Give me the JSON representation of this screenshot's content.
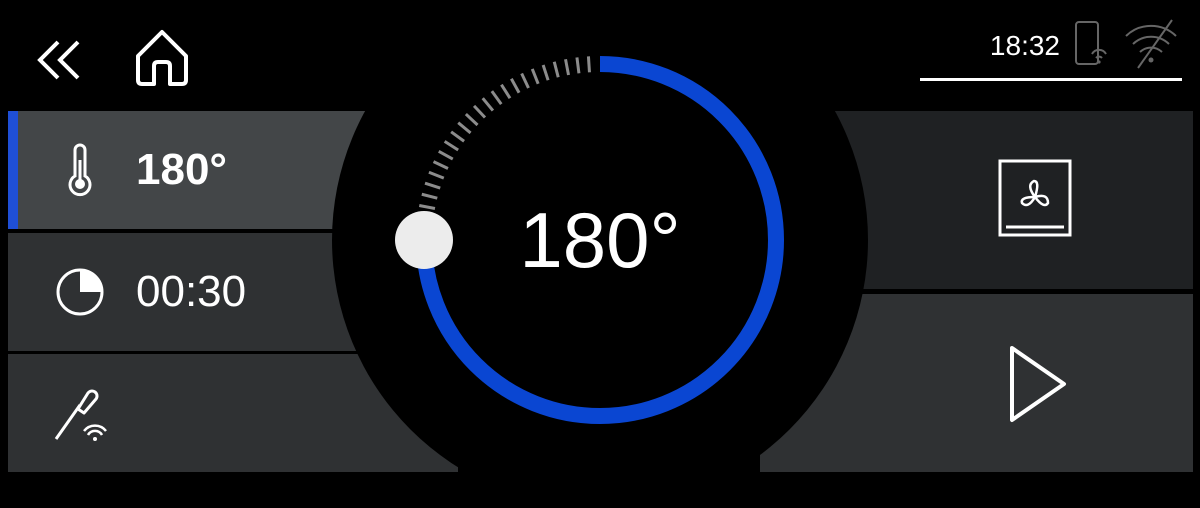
{
  "header": {
    "back_icon": "double-chevron-left-icon",
    "home_icon": "home-icon",
    "clock": "18:32",
    "phone_icon": "phone-remote-icon",
    "wifi_icon": "wifi-off-icon"
  },
  "settings": {
    "temperature": {
      "icon": "thermometer-icon",
      "value": "180°",
      "selected": true
    },
    "duration": {
      "icon": "timer-pie-icon",
      "value": "00:30"
    },
    "probe": {
      "icon": "wireless-probe-icon"
    }
  },
  "dial": {
    "value": "180°",
    "level": 0.75,
    "accent_color": "#0a46d2",
    "track_color": "#8c8c8c",
    "knob_color": "#ececec"
  },
  "actions": {
    "mode_icon": "fan-oven-mode-icon",
    "start_icon": "play-icon"
  },
  "colors": {
    "accent": "#1f4fd6",
    "panel": "#2f3133",
    "panel_selected": "#434648",
    "panel_dark": "#1f2123"
  }
}
